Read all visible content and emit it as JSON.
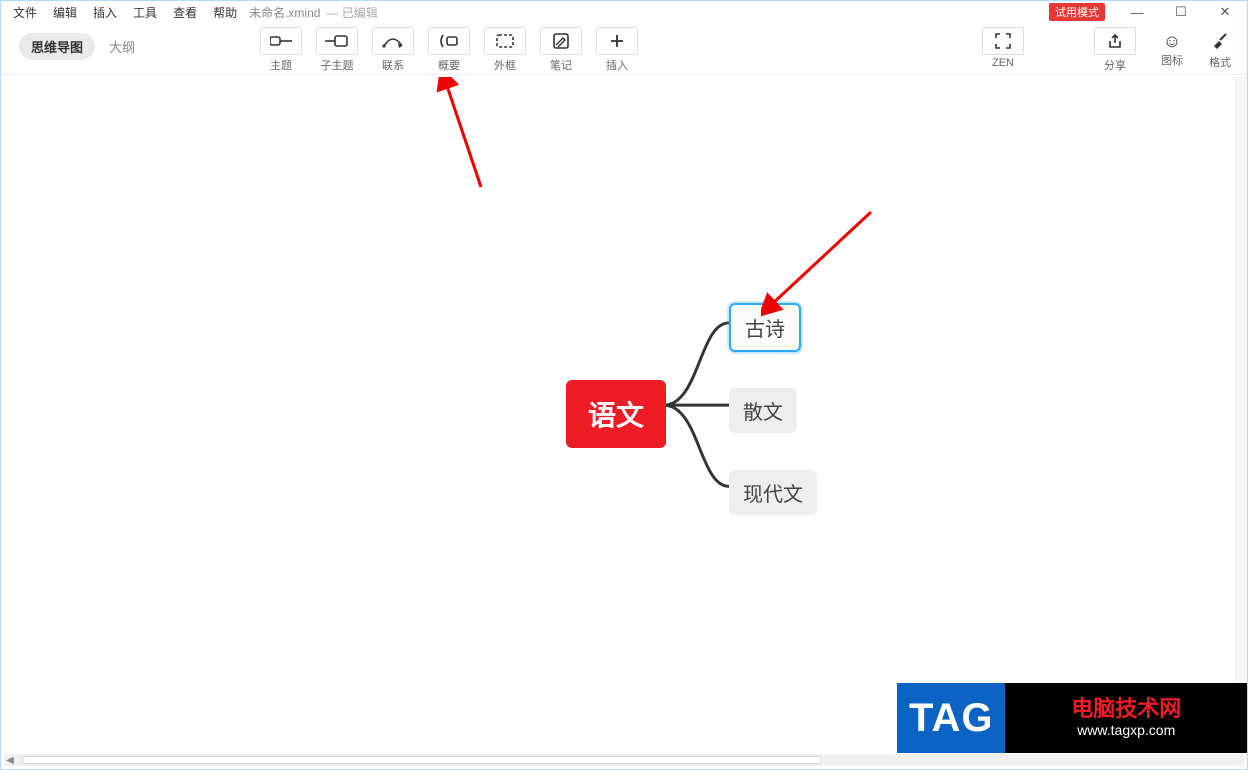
{
  "menu": {
    "items": [
      "文件",
      "编辑",
      "插入",
      "工具",
      "查看",
      "帮助"
    ],
    "filename": "未命名.xmind",
    "status": "— 已编辑"
  },
  "window": {
    "trial": "试用模式",
    "min": "—",
    "max": "☐",
    "close": "✕"
  },
  "view": {
    "mindmap": "思维导图",
    "outline": "大纲"
  },
  "tools": [
    {
      "label": "主题",
      "icon": "topic"
    },
    {
      "label": "子主题",
      "icon": "subtopic"
    },
    {
      "label": "联系",
      "icon": "relation"
    },
    {
      "label": "概要",
      "icon": "summary"
    },
    {
      "label": "外框",
      "icon": "boundary"
    },
    {
      "label": "笔记",
      "icon": "note"
    },
    {
      "label": "插入",
      "icon": "insert"
    }
  ],
  "rightTools": {
    "zen": "ZEN",
    "share": "分享"
  },
  "farTools": {
    "icons": "图标",
    "format": "格式"
  },
  "mindmap": {
    "root": "语文",
    "children": [
      "古诗",
      "散文",
      "现代文"
    ],
    "selected_index": 0
  },
  "watermark": {
    "tag": "TAG",
    "title": "电脑技术网",
    "url": "www.tagxp.com"
  }
}
